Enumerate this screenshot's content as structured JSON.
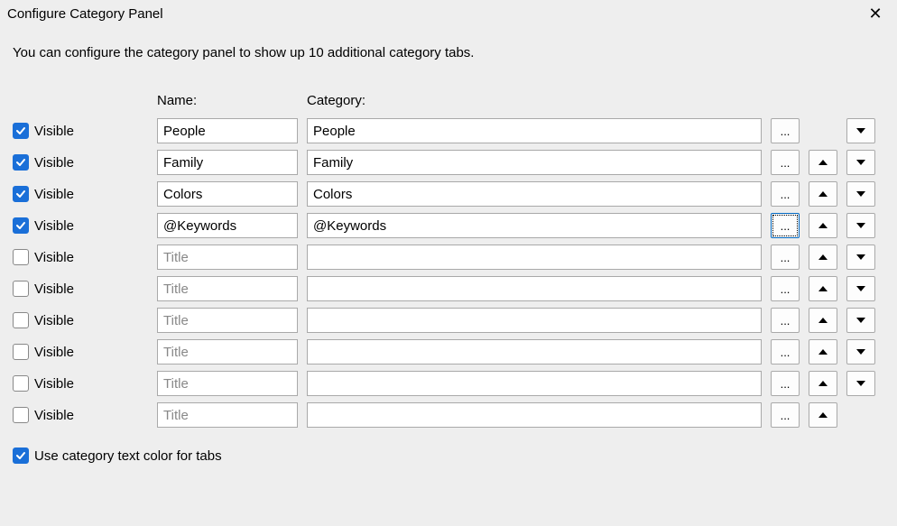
{
  "window": {
    "title": "Configure Category Panel",
    "close_glyph": "✕"
  },
  "description": "You can configure the category panel to show up 10 additional category tabs.",
  "headers": {
    "name": "Name:",
    "category": "Category:"
  },
  "visible_label": "Visible",
  "name_placeholder": "Title",
  "browse_label": "...",
  "rows": [
    {
      "visible": true,
      "name": "People",
      "category": "People",
      "has_up": false,
      "has_down": true,
      "browse_focused": false
    },
    {
      "visible": true,
      "name": "Family",
      "category": "Family",
      "has_up": true,
      "has_down": true,
      "browse_focused": false
    },
    {
      "visible": true,
      "name": "Colors",
      "category": "Colors",
      "has_up": true,
      "has_down": true,
      "browse_focused": false
    },
    {
      "visible": true,
      "name": "@Keywords",
      "category": "@Keywords",
      "has_up": true,
      "has_down": true,
      "browse_focused": true
    },
    {
      "visible": false,
      "name": "",
      "category": "",
      "has_up": true,
      "has_down": true,
      "browse_focused": false
    },
    {
      "visible": false,
      "name": "",
      "category": "",
      "has_up": true,
      "has_down": true,
      "browse_focused": false
    },
    {
      "visible": false,
      "name": "",
      "category": "",
      "has_up": true,
      "has_down": true,
      "browse_focused": false
    },
    {
      "visible": false,
      "name": "",
      "category": "",
      "has_up": true,
      "has_down": true,
      "browse_focused": false
    },
    {
      "visible": false,
      "name": "",
      "category": "",
      "has_up": true,
      "has_down": true,
      "browse_focused": false
    },
    {
      "visible": false,
      "name": "",
      "category": "",
      "has_up": true,
      "has_down": false,
      "browse_focused": false
    }
  ],
  "footer": {
    "use_color_label": "Use category text color for tabs",
    "use_color_checked": true
  }
}
